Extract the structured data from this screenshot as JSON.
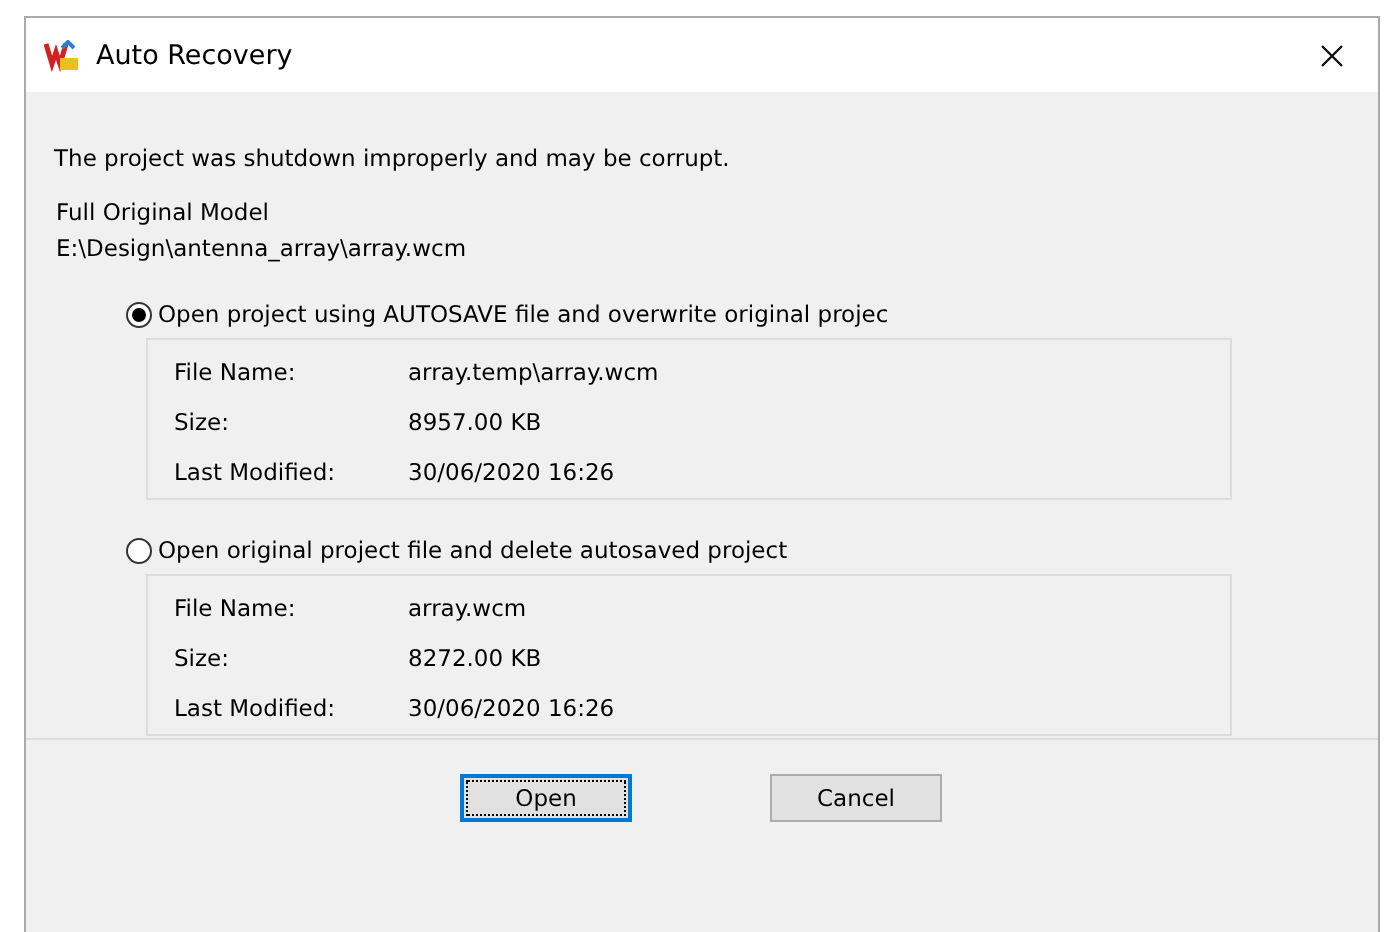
{
  "window": {
    "title": "Auto Recovery"
  },
  "message": "The project was shutdown improperly and may be corrupt.",
  "original_model": {
    "label": "Full Original Model",
    "path": "E:\\Design\\antenna_array\\array.wcm"
  },
  "options": [
    {
      "label": "Open project using AUTOSAVE file and overwrite original projec",
      "selected": true,
      "fields": [
        {
          "label": "File Name:",
          "value": "array.temp\\array.wcm"
        },
        {
          "label": "Size:",
          "value": "8957.00 KB"
        },
        {
          "label": "Last Modified:",
          "value": "30/06/2020 16:26"
        }
      ]
    },
    {
      "label": "Open original project file and delete autosaved project",
      "selected": false,
      "fields": [
        {
          "label": "File Name:",
          "value": "array.wcm"
        },
        {
          "label": "Size:",
          "value": "8272.00 KB"
        },
        {
          "label": "Last Modified:",
          "value": "30/06/2020 16:26"
        }
      ]
    }
  ],
  "buttons": [
    {
      "label": "Open",
      "focused": true
    },
    {
      "label": "Cancel",
      "focused": false
    }
  ]
}
